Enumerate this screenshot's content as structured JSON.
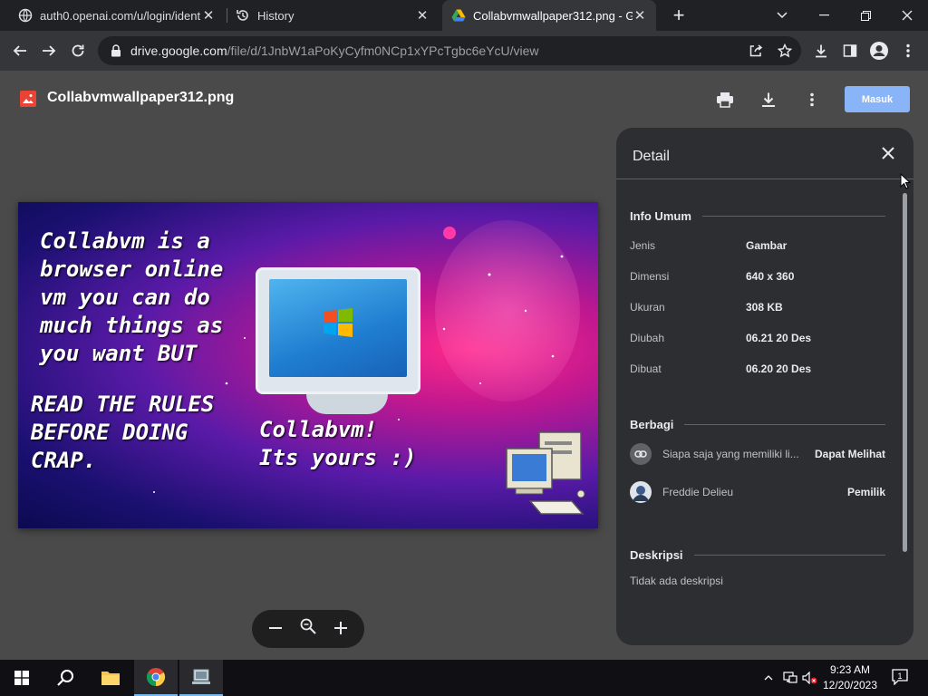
{
  "browser": {
    "tabs": [
      {
        "title": "auth0.openai.com/u/login/identi",
        "active": false
      },
      {
        "title": "History",
        "active": false
      },
      {
        "title": "Collabvmwallpaper312.png - Go",
        "active": true
      }
    ],
    "url_domain": "drive.google.com",
    "url_path": "/file/d/1JnbW1aPoKyCyfm0NCp1xYPcTgbc6eYcU/view"
  },
  "drive": {
    "file_name": "Collabvmwallpaper312.png",
    "signin_label": "Masuk"
  },
  "image": {
    "text_main": "Collabvm is a\nbrowser online\nvm you can do\nmuch things as\nyou want BUT",
    "text_rules": "READ THE RULES\nBEFORE DOING\nCRAP.",
    "text_yours": "Collabvm!\nIts yours :)"
  },
  "details": {
    "title": "Detail",
    "general_heading": "Info Umum",
    "props": [
      {
        "key": "Jenis",
        "value": "Gambar"
      },
      {
        "key": "Dimensi",
        "value": "640 x 360"
      },
      {
        "key": "Ukuran",
        "value": "308 KB"
      },
      {
        "key": "Diubah",
        "value": "06.21 20 Des"
      },
      {
        "key": "Dibuat",
        "value": "06.20 20 Des"
      }
    ],
    "share_heading": "Berbagi",
    "share": [
      {
        "who": "Siapa saja yang memiliki li...",
        "role": "Dapat Melihat"
      },
      {
        "who": "Freddie Delieu",
        "role": "Pemilik"
      }
    ],
    "desc_heading": "Deskripsi",
    "desc_text": "Tidak ada deskripsi"
  },
  "taskbar": {
    "time": "9:23 AM",
    "date": "12/20/2023",
    "notification_count": "1"
  },
  "colors": {
    "accent": "#8ab4f8",
    "panel": "#2d2e31",
    "viewer_bg": "#4a4a4a"
  }
}
